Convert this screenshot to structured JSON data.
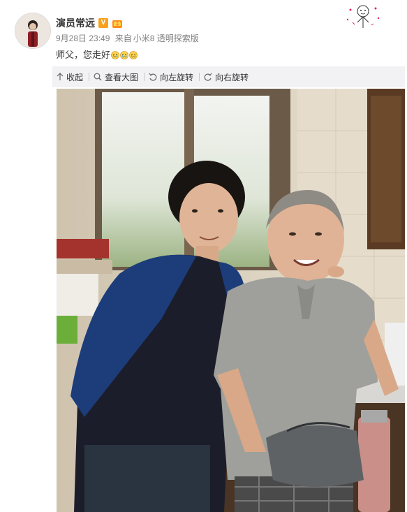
{
  "author": {
    "name": "演员常远",
    "verified_label": "V"
  },
  "meta": {
    "timestamp": "9月28日 23:49",
    "source_prefix": "来自",
    "source": "小米8 透明探索版"
  },
  "post": {
    "text": "师父，您走好"
  },
  "toolbar": {
    "collapse_label": "收起",
    "view_large_label": "查看大图",
    "rotate_left_label": "向左旋转",
    "rotate_right_label": "向右旋转"
  },
  "icons": {
    "collapse": "arrow-up-icon",
    "view_large": "magnifier-icon",
    "rotate_left": "rotate-left-icon",
    "rotate_right": "rotate-right-icon"
  },
  "colors": {
    "verified": "#f7a21a",
    "toolbar_bg": "#f2f2f5",
    "meta_text": "#808080"
  }
}
